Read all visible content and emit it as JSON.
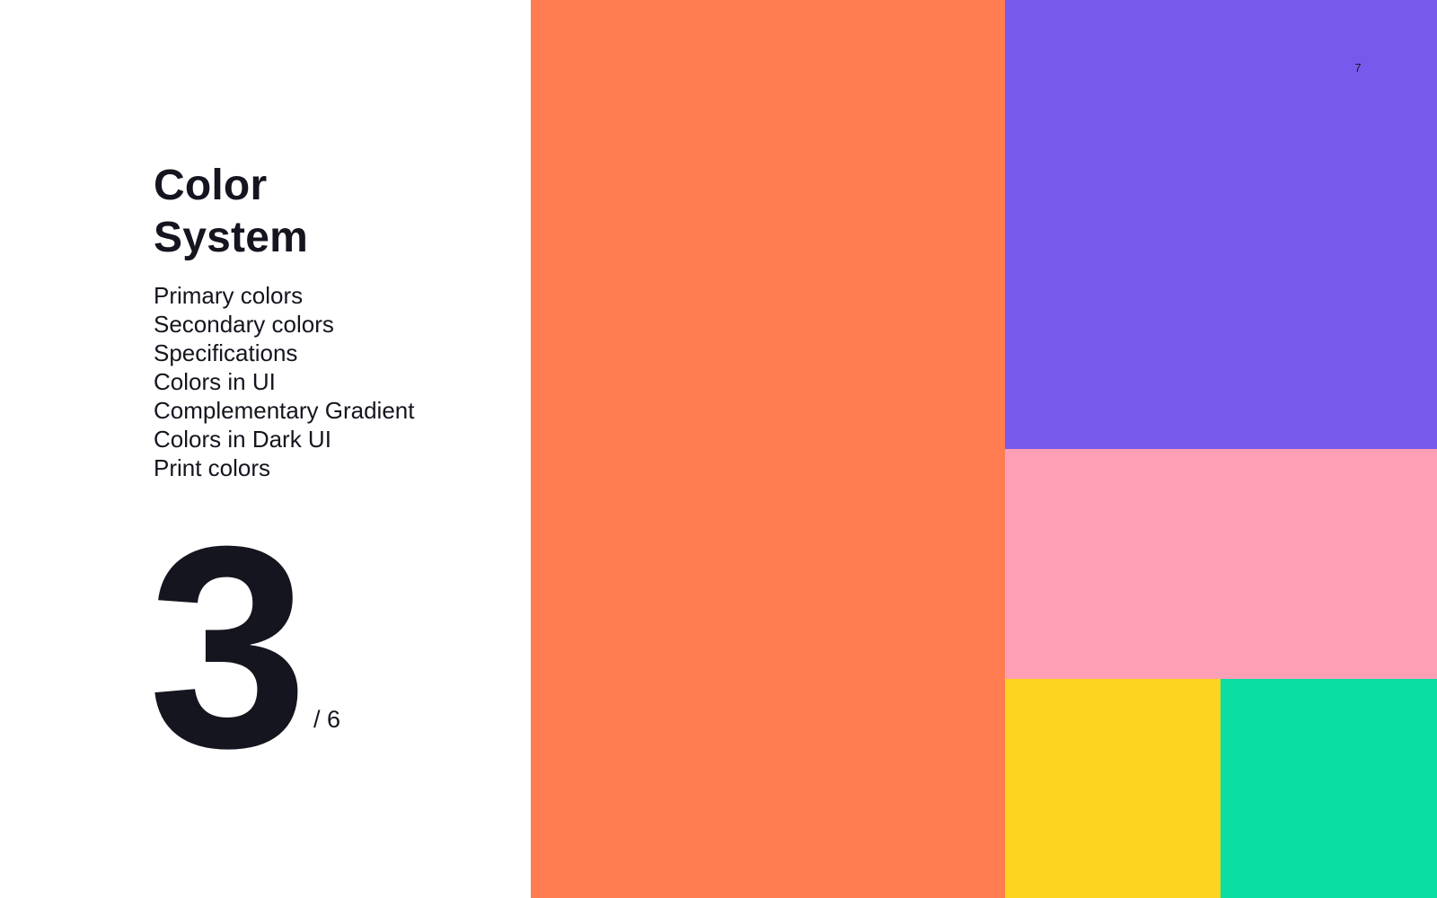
{
  "page": {
    "number": "7"
  },
  "section": {
    "title_line1": "Color",
    "title_line2": "System",
    "number": "3",
    "total": "/ 6"
  },
  "toc": {
    "items": [
      "Primary colors",
      "Secondary colors",
      "Specifications",
      "Colors in UI",
      "Complementary Gradient",
      "Colors in Dark UI",
      "Print colors"
    ]
  },
  "swatches": {
    "orange": "#ff7d51",
    "purple": "#775aec",
    "pink": "#ff9fb6",
    "yellow": "#fdd41e",
    "green": "#0bdea2"
  },
  "colors": {
    "text": "#15151f",
    "background": "#ffffff"
  }
}
